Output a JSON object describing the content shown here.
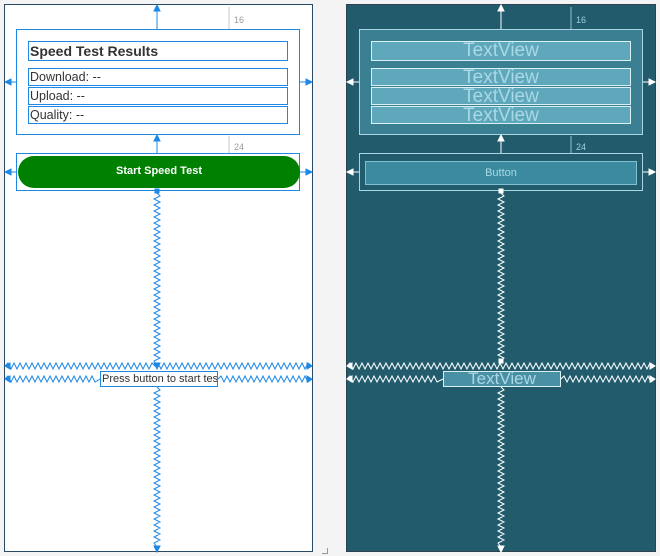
{
  "design": {
    "title": "Speed Test Results",
    "download": "Download: --",
    "upload": "Upload: --",
    "quality": "Quality: --",
    "button_label": "Start Speed Test",
    "status": "Press button to start test",
    "margin_top": "16",
    "margin_button": "24"
  },
  "blueprint": {
    "textview_label": "TextView",
    "button_label": "Button",
    "margin_top": "16",
    "margin_button": "24"
  },
  "colors": {
    "button_green": "#008000",
    "constraint_blue": "#1e88e5",
    "blueprint_bg": "#215b6c"
  }
}
